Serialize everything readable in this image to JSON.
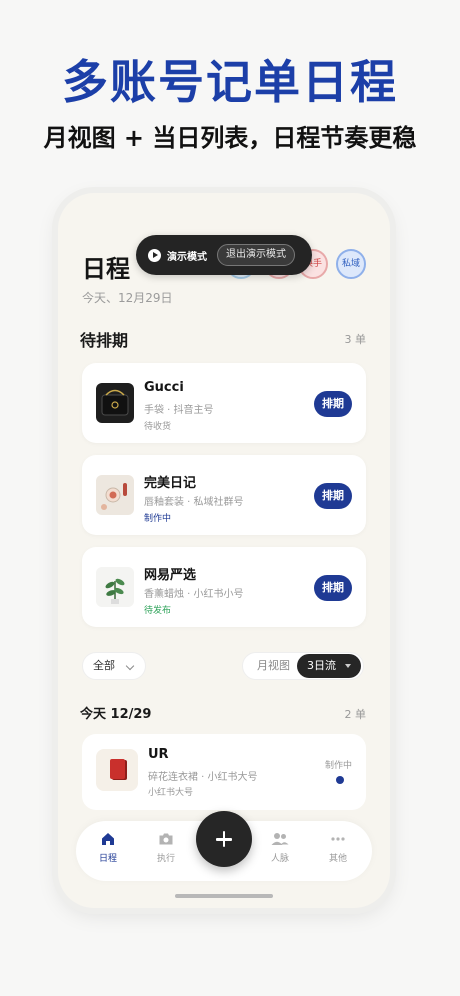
{
  "hero": {
    "title": "多账号记单日程",
    "subtitle": "月视图 + 当日列表，日程节奏更稳"
  },
  "header": {
    "title": "日程",
    "date": "今天、12月29日"
  },
  "demo": {
    "label": "演示模式",
    "exit_label": "退出演示模式"
  },
  "accounts": [
    {
      "label": ""
    },
    {
      "label": ""
    },
    {
      "label": "换手"
    },
    {
      "label": "私域"
    }
  ],
  "pending": {
    "title": "待排期",
    "count": "3 单",
    "items": [
      {
        "name": "Gucci",
        "meta": "手袋 · 抖音主号",
        "status": "待收货",
        "status_color": "#999999",
        "button": "排期"
      },
      {
        "name": "完美日记",
        "meta": "唇釉套装 · 私域社群号",
        "status": "制作中",
        "status_color": "#1f3a94",
        "button": "排期"
      },
      {
        "name": "网易严选",
        "meta": "香薰蜡烛 · 小红书小号",
        "status": "待发布",
        "status_color": "#2fa35a",
        "button": "排期"
      }
    ]
  },
  "filters": {
    "all_label": "全部",
    "month_label": "月视图",
    "three_day_label": "3日流"
  },
  "today": {
    "title": "今天 12/29",
    "count": "2 单",
    "item": {
      "name": "UR",
      "meta": "碎花连衣裙 · 小红书大号",
      "account": "小红书大号",
      "status": "制作中"
    }
  },
  "tabbar": {
    "schedule": "日程",
    "execute": "执行",
    "contacts": "人脉",
    "more": "其他"
  },
  "colors": {
    "brand": "#1c3fa8",
    "button": "#1f3a94",
    "active_tab": "#1f3a94",
    "dark": "#262626"
  }
}
